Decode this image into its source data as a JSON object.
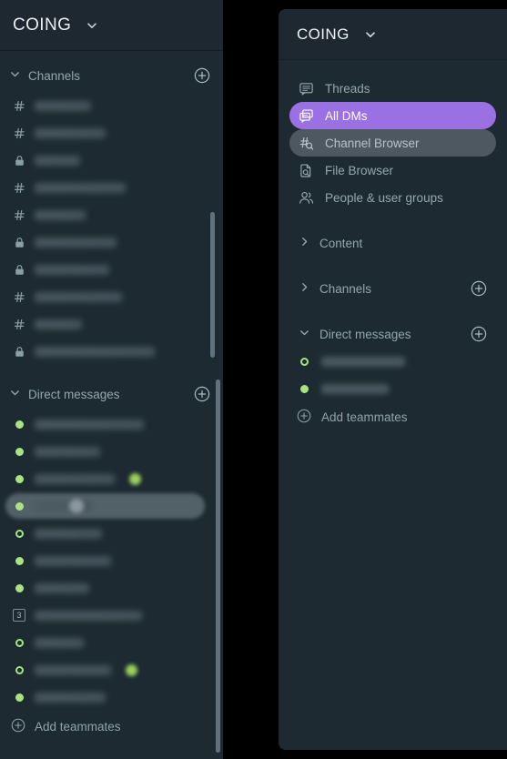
{
  "left_panel": {
    "header": {
      "workspace": "COING",
      "chevron_icon": "chevron-down-icon"
    },
    "channels_section": {
      "label": "Channels",
      "collapse_icon": "chevron-down-icon",
      "add_icon": "plus-circle-icon"
    },
    "channels": [
      {
        "icon": "hash-icon",
        "name": "",
        "width": "w1"
      },
      {
        "icon": "hash-icon",
        "name": "",
        "width": "w2"
      },
      {
        "icon": "lock-icon",
        "name": "",
        "width": "w3"
      },
      {
        "icon": "hash-icon",
        "name": "",
        "width": "w4"
      },
      {
        "icon": "hash-icon",
        "name": "",
        "width": "w5"
      },
      {
        "icon": "lock-icon",
        "name": "",
        "width": "w6"
      },
      {
        "icon": "lock-icon",
        "name": "",
        "width": "w7"
      },
      {
        "icon": "hash-icon",
        "name": "",
        "width": "w8"
      },
      {
        "icon": "hash-icon",
        "name": "",
        "width": "w9"
      },
      {
        "icon": "lock-icon",
        "name": "",
        "width": "w10"
      }
    ],
    "dm_section": {
      "label": "Direct messages",
      "collapse_icon": "chevron-down-icon",
      "add_icon": "plus-circle-icon"
    },
    "dms": [
      {
        "status": "online",
        "name": "",
        "width": "d1",
        "selected": false,
        "badge": false,
        "emoji": false
      },
      {
        "status": "online",
        "name": "",
        "width": "d2",
        "selected": false,
        "badge": false,
        "emoji": false
      },
      {
        "status": "online",
        "name": "",
        "width": "d3",
        "selected": false,
        "badge": false,
        "emoji": true
      },
      {
        "status": "online",
        "name": "",
        "width": "d4",
        "selected": true,
        "badge": true,
        "emoji": false
      },
      {
        "status": "away",
        "name": "",
        "width": "d5",
        "selected": false,
        "badge": false,
        "emoji": false
      },
      {
        "status": "online",
        "name": "",
        "width": "d6",
        "selected": false,
        "badge": false,
        "emoji": false
      },
      {
        "status": "online",
        "name": "",
        "width": "d7",
        "selected": false,
        "badge": false,
        "emoji": false
      },
      {
        "status": "group",
        "group_count": "3",
        "name": "",
        "width": "d8",
        "selected": false,
        "badge": false,
        "emoji": false
      },
      {
        "status": "away",
        "name": "",
        "width": "d9",
        "selected": false,
        "badge": false,
        "emoji": false
      },
      {
        "status": "away",
        "name": "",
        "width": "d10",
        "selected": false,
        "badge": false,
        "emoji": true
      },
      {
        "status": "online",
        "name": "",
        "width": "d11",
        "selected": false,
        "badge": false,
        "emoji": false
      }
    ],
    "add_teammates": {
      "label": "Add teammates",
      "icon": "plus-circle-icon"
    }
  },
  "right_panel": {
    "header": {
      "workspace": "COING",
      "chevron_icon": "chevron-down-icon"
    },
    "nav_items": [
      {
        "label": "Threads",
        "icon": "threads-icon",
        "state": "default"
      },
      {
        "label": "All DMs",
        "icon": "all-dms-icon",
        "state": "active"
      },
      {
        "label": "Channel Browser",
        "icon": "channel-browser-icon",
        "state": "hover"
      },
      {
        "label": "File Browser",
        "icon": "file-browser-icon",
        "state": "default"
      },
      {
        "label": "People & user groups",
        "icon": "people-icon",
        "state": "default"
      }
    ],
    "content_section": {
      "label": "Content",
      "collapse_icon": "chevron-right-icon"
    },
    "channels_section": {
      "label": "Channels",
      "collapse_icon": "chevron-right-icon",
      "add_icon": "plus-circle-icon"
    },
    "dm_section": {
      "label": "Direct messages",
      "collapse_icon": "chevron-down-icon",
      "add_icon": "plus-circle-icon"
    },
    "dms": [
      {
        "status": "away",
        "name": "",
        "width": "n1"
      },
      {
        "status": "online",
        "name": "",
        "width": "n2"
      }
    ],
    "add_teammates": {
      "label": "Add teammates",
      "icon": "plus-circle-icon"
    }
  },
  "colors": {
    "panel_bg": "#1d2a31",
    "header_bg": "#1e2830",
    "accent_purple": "#9a70e2",
    "hover_gray": "#4d5860",
    "status_green": "#a8e47f",
    "text_muted": "#93a7b1",
    "text_bright": "#eef3f6"
  }
}
